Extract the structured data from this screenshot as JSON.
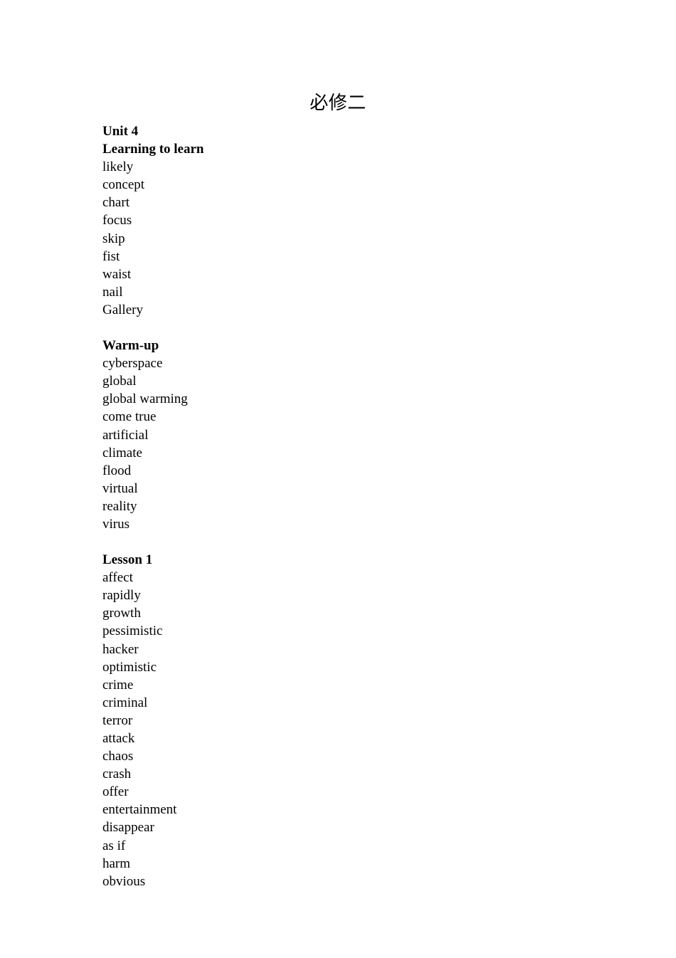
{
  "document": {
    "title": "必修二",
    "sections": [
      {
        "headings": [
          "Unit 4",
          "Learning to learn"
        ],
        "words": [
          "likely",
          "concept",
          "chart",
          "focus",
          "skip",
          "fist",
          "waist",
          "nail",
          "Gallery"
        ]
      },
      {
        "headings": [
          "Warm-up"
        ],
        "words": [
          "cyberspace",
          "global",
          "global warming",
          "come true",
          "artificial",
          "climate",
          "flood",
          "virtual",
          "reality",
          "virus"
        ]
      },
      {
        "headings": [
          "Lesson 1"
        ],
        "words": [
          "affect",
          "rapidly",
          "growth",
          "pessimistic",
          "hacker",
          "optimistic",
          "crime",
          "criminal",
          "terror",
          "attack",
          "chaos",
          "crash",
          "offer",
          "entertainment",
          "disappear",
          "as if",
          "harm",
          "obvious"
        ]
      }
    ]
  }
}
